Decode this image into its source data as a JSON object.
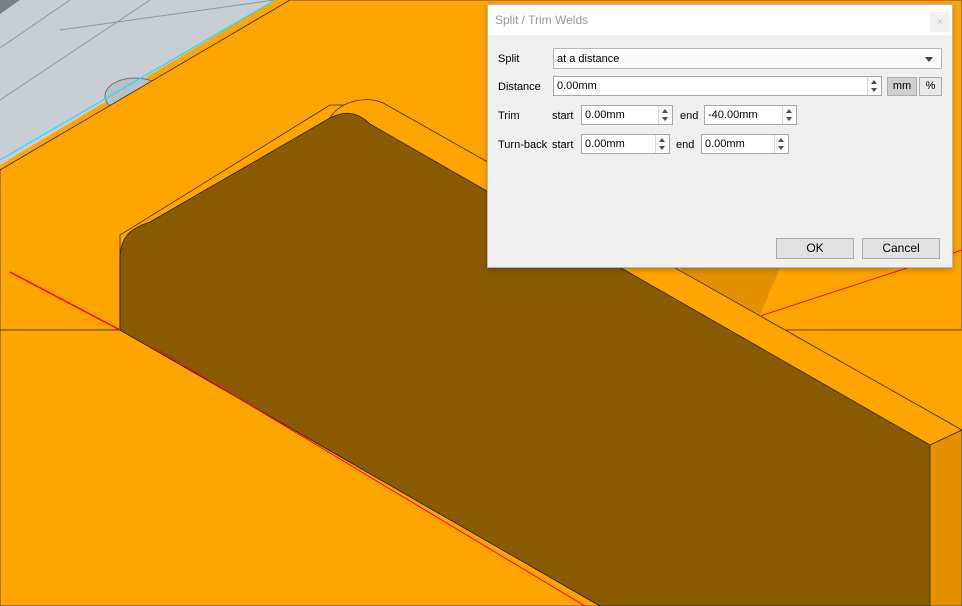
{
  "dialog": {
    "title": "Split / Trim Welds",
    "close_glyph": "×",
    "split": {
      "label": "Split",
      "value": "at a distance"
    },
    "distance": {
      "label": "Distance",
      "value": "0.00mm",
      "unit_mm": "mm",
      "unit_percent": "%",
      "active_unit": "mm"
    },
    "trim": {
      "label": "Trim",
      "start_label": "start",
      "start_value": "0.00mm",
      "end_label": "end",
      "end_value": "-40.00mm"
    },
    "turnback": {
      "label": "Turn-back",
      "start_label": "start",
      "start_value": "0.00mm",
      "end_label": "end",
      "end_value": "0.00mm"
    },
    "ok_label": "OK",
    "cancel_label": "Cancel"
  },
  "colors": {
    "part_face": "#ffa500",
    "part_shadow": "#8a5a00",
    "part_side": "#e39100",
    "weld_line": "#ff0000",
    "background_metal": "#c8ced3",
    "edge_highlight": "#00e5ff"
  }
}
